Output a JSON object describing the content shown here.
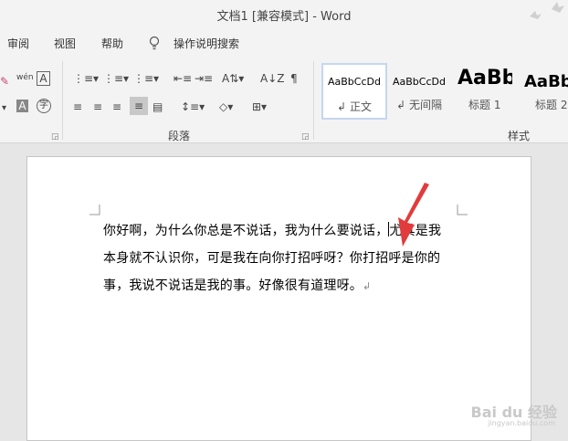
{
  "window": {
    "title": "文档1 [兼容模式] - Word"
  },
  "menu": {
    "review": "审阅",
    "view": "视图",
    "help": "帮助",
    "tell_me": "操作说明搜索"
  },
  "ribbon": {
    "paragraph_label": "段落",
    "styles_label": "样式",
    "font_icons": {
      "wen": "wén",
      "A": "A",
      "zi": "字"
    },
    "styles": [
      {
        "sample": "AaBbCcDd",
        "name": "正文"
      },
      {
        "sample": "AaBbCcDd",
        "name": "无间隔"
      },
      {
        "sample": "AaBb",
        "name": "标题 1"
      },
      {
        "sample": "AaBb",
        "name": "标题 2"
      }
    ],
    "style_marks": [
      "↲",
      "↲"
    ]
  },
  "document": {
    "lines": [
      "你好啊，为什么你总是不说话，我为什么要说话，",
      "尤其是我",
      "本身就不认识你，可是我在向你打招呼呀？你打招呼是你的",
      "事，我说不说话是我的事。好像很有道理呀。"
    ],
    "para_mark": "↲"
  },
  "watermark": {
    "text": "Bai du 经验",
    "sub": "jingyan.baidu.com"
  }
}
